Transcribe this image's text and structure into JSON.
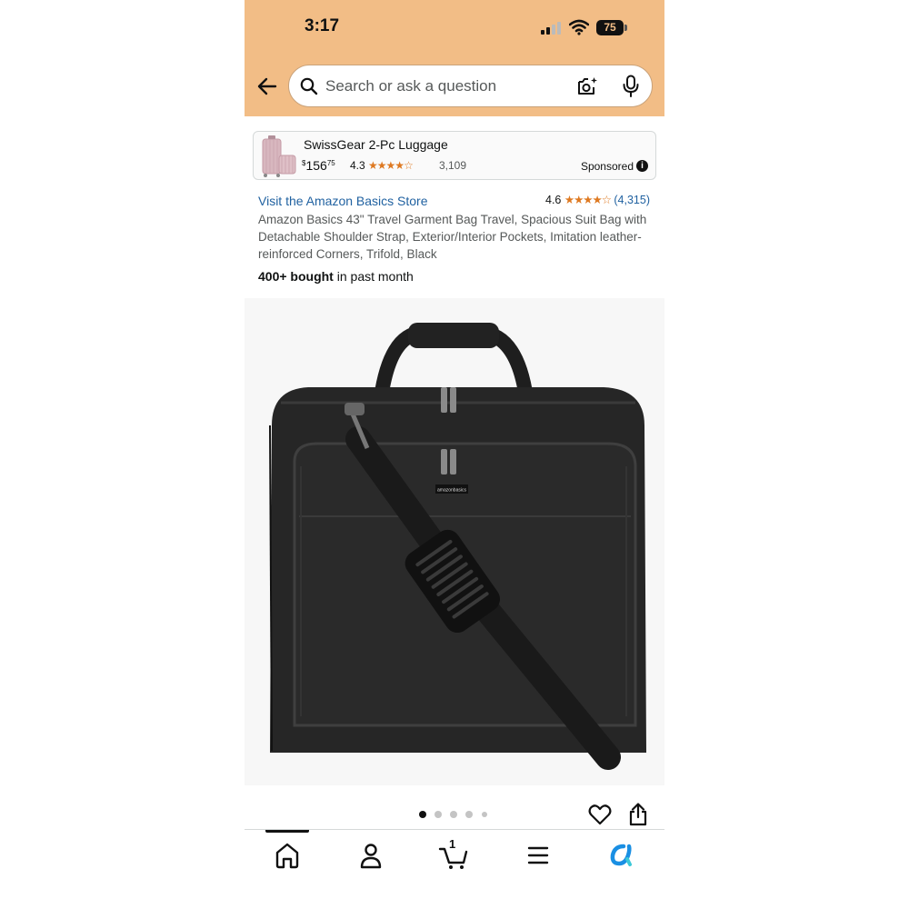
{
  "status_bar": {
    "time": "3:17",
    "battery": "75"
  },
  "search": {
    "placeholder": "Search or ask a question"
  },
  "sponsored_ad": {
    "title": "SwissGear 2-Pc Luggage",
    "price_currency": "$",
    "price_whole": "156",
    "price_fraction": "75",
    "rating": "4.3",
    "stars": "★★★★☆",
    "review_count": "3,109",
    "sponsored_label": "Sponsored"
  },
  "product": {
    "store_link": "Visit the Amazon Basics Store",
    "rating": "4.6",
    "stars": "★★★★☆",
    "review_count": "(4,315)",
    "title": "Amazon Basics 43\" Travel Garment Bag Travel, Spacious Suit Bag with Detachable Shoulder Strap, Exterior/Interior Pockets, Imitation leather-reinforced Corners, Trifold, Black",
    "bought_bold": "400+ bought",
    "bought_rest": " in past month",
    "image_brand_tag": "amazonbasics"
  },
  "carousel": {
    "total": 5,
    "active": 1
  },
  "bottom_nav": {
    "items": [
      "home-icon",
      "account-icon",
      "cart-icon",
      "menu-icon",
      "rufus-icon"
    ],
    "cart_count": "1"
  },
  "colors": {
    "header_bg": "#f2bd86",
    "link": "#2162a1",
    "star": "#de7921",
    "rufus": "#1a8fe3"
  }
}
